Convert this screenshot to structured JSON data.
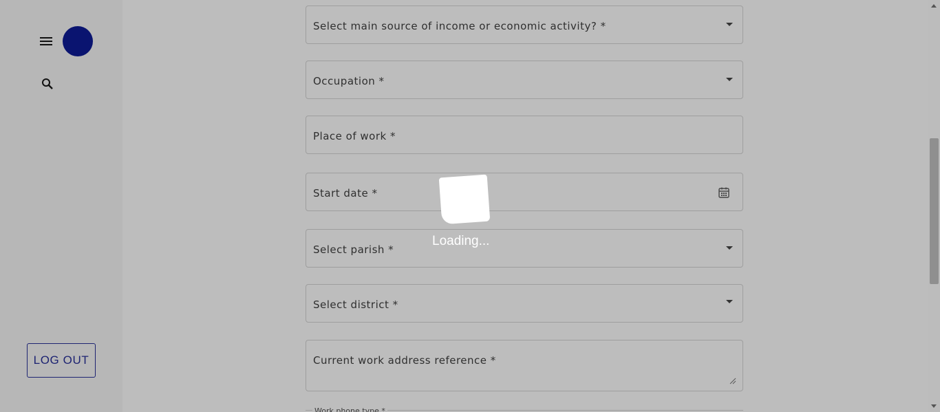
{
  "sidebar": {
    "menu_icon": "menu-icon",
    "search_icon": "search-icon",
    "logout_label": "LOG OUT"
  },
  "form": {
    "fields": [
      {
        "label": "Select main source of income or economic activity? *",
        "type": "select"
      },
      {
        "label": "Occupation *",
        "type": "select"
      },
      {
        "label": "Place of work *",
        "type": "text"
      },
      {
        "label": "Start date *",
        "type": "date"
      },
      {
        "label": "Select parish *",
        "type": "select"
      },
      {
        "label": "Select district *",
        "type": "select"
      },
      {
        "label": "Current work address reference *",
        "type": "textarea"
      }
    ],
    "partial_field_label": "Work phone type *"
  },
  "overlay": {
    "loading_text": "Loading..."
  },
  "colors": {
    "accent": "#0a1470",
    "overlay_background": "#bdbdbd"
  }
}
